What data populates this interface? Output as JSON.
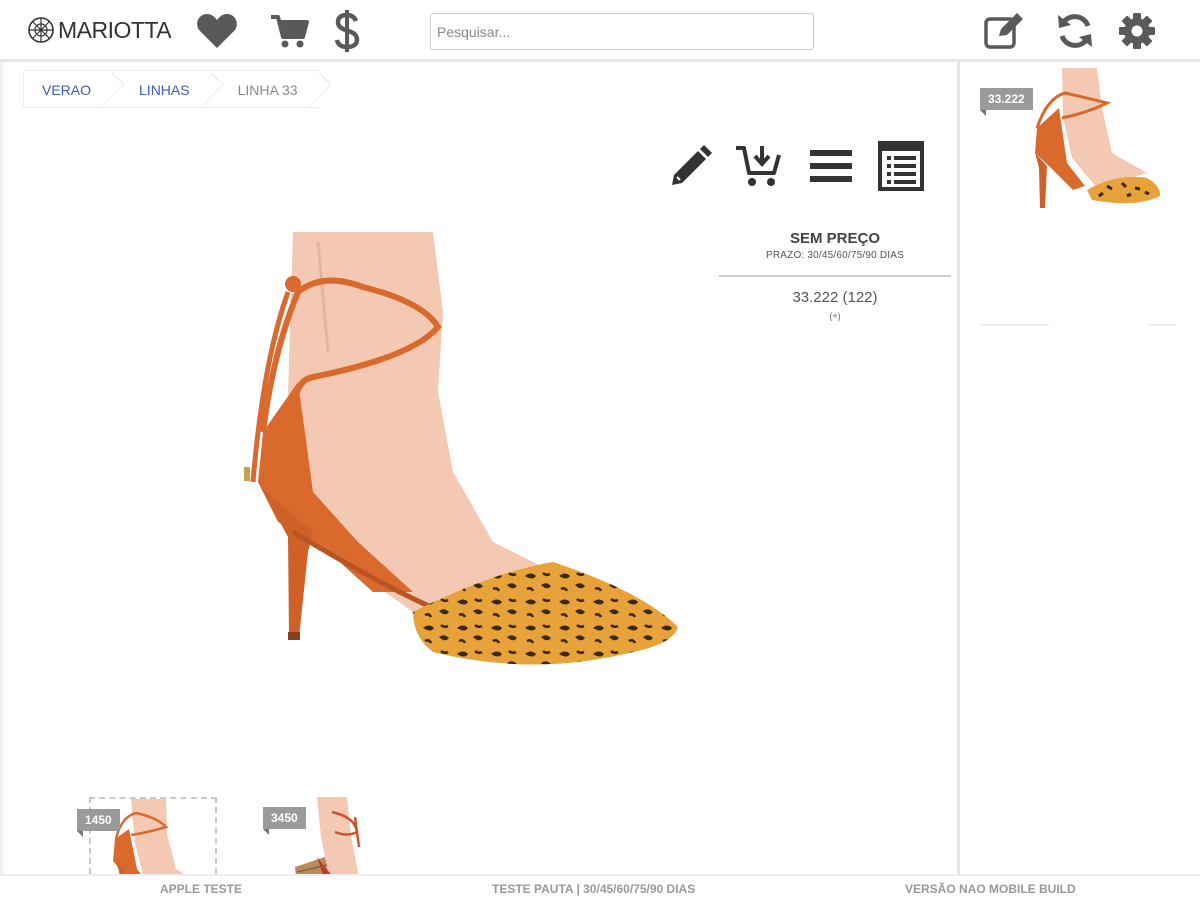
{
  "header": {
    "logo_text": "MARIOTTA",
    "search_placeholder": "Pesquisar...",
    "icons": [
      "heart-icon",
      "cart-icon",
      "dollar-icon",
      "edit-icon",
      "refresh-icon",
      "gear-icon"
    ]
  },
  "breadcrumb": [
    {
      "label": "VERAO"
    },
    {
      "label": "LINHAS"
    },
    {
      "label": "LINHA 33"
    }
  ],
  "toolbar": {
    "icons": [
      "pencil-icon",
      "add-to-cart-icon",
      "menu-icon",
      "list-details-icon"
    ]
  },
  "product": {
    "price_label": "SEM PREÇO",
    "prazo": "PRAZO: 30/45/60/75/90 DIAS",
    "reference": "33.222 (122)",
    "plus": "(+)"
  },
  "thumbnails": [
    {
      "tag": "1450",
      "selected": true
    },
    {
      "tag": "3450",
      "selected": false
    }
  ],
  "sidebar": {
    "card_tag": "33.222"
  },
  "footer": {
    "left": "APPLE TESTE",
    "center": "TESTE PAUTA | 30/45/60/75/90 DIAS",
    "right": "VERSÃO NAO MOBILE BUILD"
  },
  "colors": {
    "link": "#3a5bbd",
    "icon": "#595959",
    "tag_bg": "#9a9a9a",
    "leather": "#d9692c",
    "leopard": "#e7a23a"
  }
}
